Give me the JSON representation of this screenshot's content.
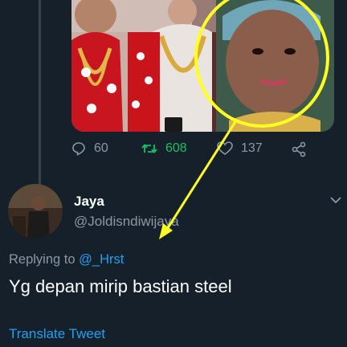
{
  "tweet": {
    "reply_count": "60",
    "retweet_count": "608",
    "like_count": "137"
  },
  "reply": {
    "display_name": "Jaya",
    "handle": "@Joldisndiwijaya",
    "replying_prefix": "Replying to",
    "replying_to": "@_Hrst",
    "text": "Yg depan mirip bastian steel",
    "translate_label": "Translate Tweet"
  },
  "icons": {
    "reply": "reply-icon",
    "retweet": "retweet-icon",
    "like": "heart-icon",
    "share": "share-icon",
    "more": "chevron-down-icon"
  },
  "colors": {
    "background": "#15202b",
    "secondary_text": "#8899a6",
    "link": "#1da1f2",
    "retweet_active": "#17bf63",
    "annotation": "#ffff22"
  }
}
